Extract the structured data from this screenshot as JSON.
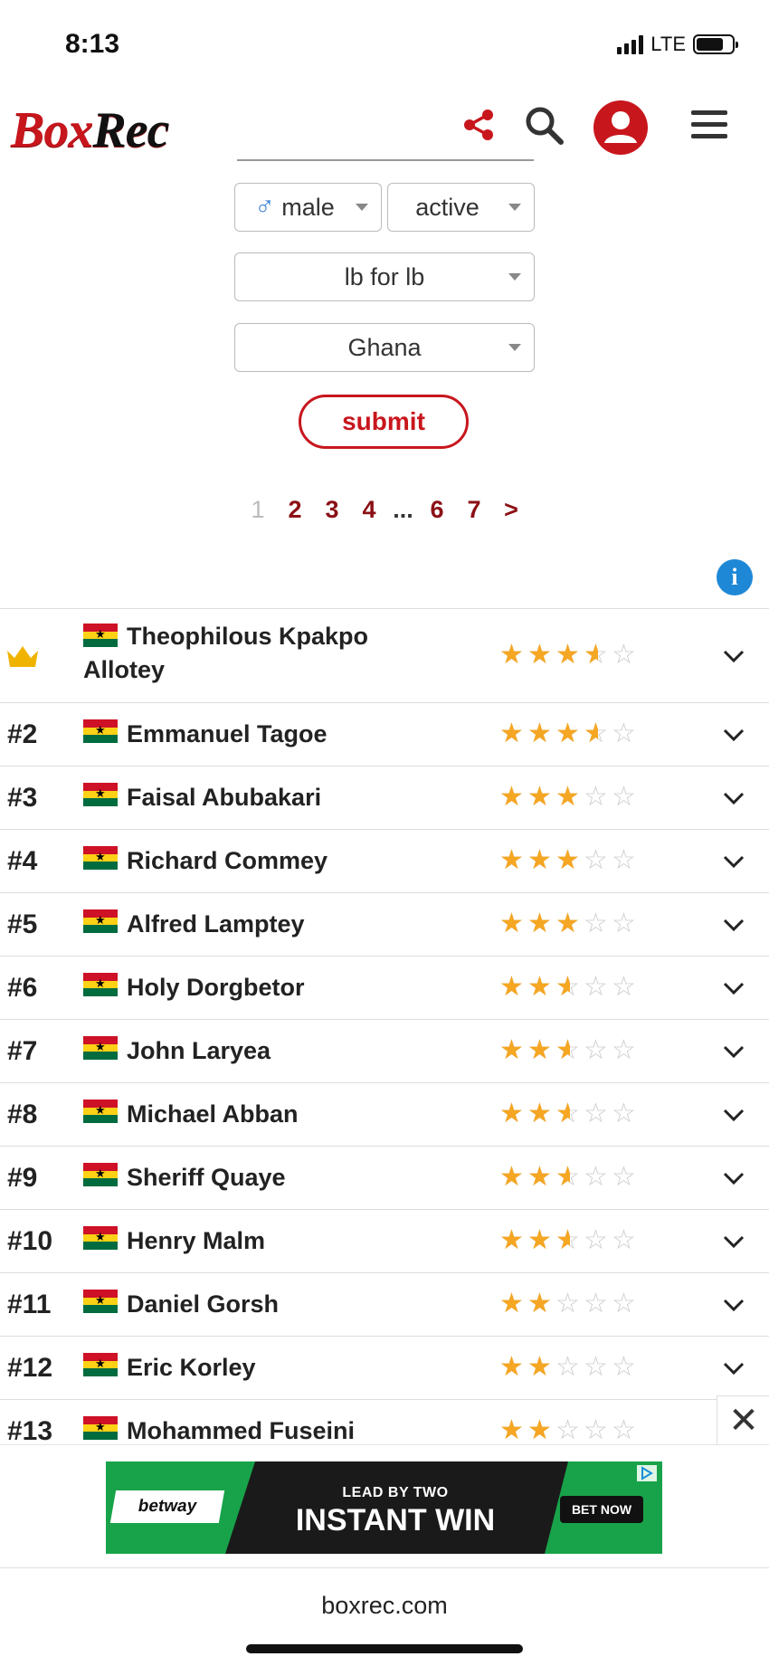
{
  "status_bar": {
    "time": "8:13",
    "network": "LTE"
  },
  "header": {
    "logo_part1": "Box",
    "logo_part2": "Rec",
    "brand_color": "#c8161d",
    "icons": [
      "share-icon",
      "search-icon",
      "account-icon",
      "menu-icon"
    ]
  },
  "filters": {
    "gender": {
      "symbol": "♂",
      "value": "male"
    },
    "status": {
      "value": "active"
    },
    "weight": {
      "value": "lb for lb"
    },
    "country": {
      "value": "Ghana"
    },
    "submit_label": "submit"
  },
  "pagination": {
    "pages": [
      "1",
      "2",
      "3",
      "4",
      "...",
      "6",
      "7",
      ">"
    ],
    "current": "1"
  },
  "info_icon": "i",
  "rankings": [
    {
      "rank": "crown",
      "name": "Theophilous Kpakpo Allotey",
      "rating": 3.5
    },
    {
      "rank": "#2",
      "name": "Emmanuel Tagoe",
      "rating": 3.5
    },
    {
      "rank": "#3",
      "name": "Faisal Abubakari",
      "rating": 3
    },
    {
      "rank": "#4",
      "name": "Richard Commey",
      "rating": 3
    },
    {
      "rank": "#5",
      "name": "Alfred Lamptey",
      "rating": 3
    },
    {
      "rank": "#6",
      "name": "Holy Dorgbetor",
      "rating": 2.5
    },
    {
      "rank": "#7",
      "name": "John Laryea",
      "rating": 2.5
    },
    {
      "rank": "#8",
      "name": "Michael Abban",
      "rating": 2.5
    },
    {
      "rank": "#9",
      "name": "Sheriff Quaye",
      "rating": 2.5
    },
    {
      "rank": "#10",
      "name": "Henry Malm",
      "rating": 2.5
    },
    {
      "rank": "#11",
      "name": "Daniel Gorsh",
      "rating": 2
    },
    {
      "rank": "#12",
      "name": "Eric Korley",
      "rating": 2
    },
    {
      "rank": "#13",
      "name": "Mohammed Fuseini",
      "rating": 2
    }
  ],
  "ad": {
    "brand": "betway",
    "tagline": "LEAD BY TWO",
    "headline": "INSTANT WIN",
    "cta": "BET NOW",
    "close": "✕"
  },
  "browser": {
    "domain": "boxrec.com"
  }
}
